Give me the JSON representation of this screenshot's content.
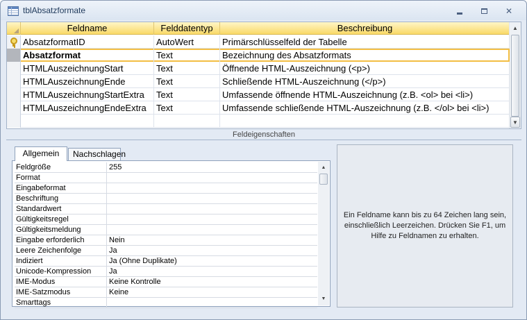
{
  "window": {
    "title": "tblAbsatzformate"
  },
  "grid": {
    "headers": {
      "name": "Feldname",
      "type": "Felddatentyp",
      "description": "Beschreibung"
    },
    "rows": [
      {
        "name": "AbsatzformatID",
        "type": "AutoWert",
        "description": "Primärschlüsselfeld der Tabelle",
        "primary_key": true,
        "selected": false
      },
      {
        "name": "Absatzformat",
        "type": "Text",
        "description": "Bezeichnung des Absatzformats",
        "primary_key": false,
        "selected": true
      },
      {
        "name": "HTMLAuszeichnungStart",
        "type": "Text",
        "description": "Öffnende HTML-Auszeichnung (<p>)",
        "primary_key": false,
        "selected": false
      },
      {
        "name": "HTMLAuszeichnungEnde",
        "type": "Text",
        "description": "Schließende HTML-Auszeichnung (</p>)",
        "primary_key": false,
        "selected": false
      },
      {
        "name": "HTMLAuszeichnungStartExtra",
        "type": "Text",
        "description": "Umfassende öffnende HTML-Auszeichnung (z.B. <ol> bei <li>)",
        "primary_key": false,
        "selected": false
      },
      {
        "name": "HTMLAuszeichnungEndeExtra",
        "type": "Text",
        "description": "Umfassende schließende HTML-Auszeichnung (z.B. </ol> bei <li>)",
        "primary_key": false,
        "selected": false
      }
    ]
  },
  "properties": {
    "section_label": "Feldeigenschaften",
    "tabs": [
      "Allgemein",
      "Nachschlagen"
    ],
    "rows": [
      {
        "label": "Feldgröße",
        "value": "255"
      },
      {
        "label": "Format",
        "value": ""
      },
      {
        "label": "Eingabeformat",
        "value": ""
      },
      {
        "label": "Beschriftung",
        "value": ""
      },
      {
        "label": "Standardwert",
        "value": ""
      },
      {
        "label": "Gültigkeitsregel",
        "value": ""
      },
      {
        "label": "Gültigkeitsmeldung",
        "value": ""
      },
      {
        "label": "Eingabe erforderlich",
        "value": "Nein"
      },
      {
        "label": "Leere Zeichenfolge",
        "value": "Ja"
      },
      {
        "label": "Indiziert",
        "value": "Ja (Ohne Duplikate)"
      },
      {
        "label": "Unicode-Kompression",
        "value": "Ja"
      },
      {
        "label": "IME-Modus",
        "value": "Keine Kontrolle"
      },
      {
        "label": "IME-Satzmodus",
        "value": "Keine"
      },
      {
        "label": "Smarttags",
        "value": ""
      }
    ],
    "help_text": "Ein Feldname kann bis zu 64 Zeichen lang sein, einschließlich Leerzeichen. Drücken Sie F1, um Hilfe zu Feldnamen zu erhalten."
  },
  "icons": {
    "window": "table-icon",
    "primary_key": "key-icon",
    "accent": "#f3be43"
  }
}
